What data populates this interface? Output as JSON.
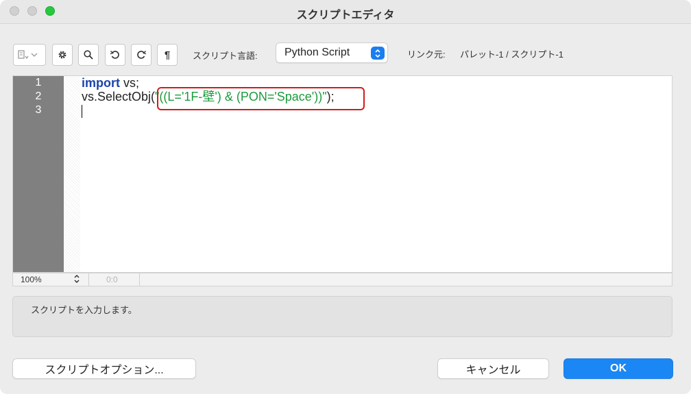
{
  "window": {
    "title": "スクリプトエディタ"
  },
  "toolbar": {
    "insert_icon": "insert-tool-icon",
    "script_language_label": "スクリプト言語:",
    "script_language_value": "Python Script",
    "link_label": "リンク元:",
    "link_value": "パレット-1 / スクリプト-1"
  },
  "editor": {
    "line_numbers": [
      "1",
      "2",
      "3"
    ],
    "line1_keyword": "import",
    "line1_rest": " vs;",
    "line2_prefix": "vs.SelectObj(",
    "line2_string": "\"((L='1F-壁') & (PON='Space'))\"",
    "line2_suffix": ");",
    "highlight_color": "#d11b1b"
  },
  "status": {
    "zoom": "100%",
    "position": "0:0"
  },
  "message": {
    "text": "スクリプトを入力します。"
  },
  "buttons": {
    "options": "スクリプトオプション...",
    "cancel": "キャンセル",
    "ok": "OK"
  },
  "colors": {
    "accent": "#1a87f5",
    "keyword": "#1a44a8",
    "string": "#1b9a3c"
  }
}
